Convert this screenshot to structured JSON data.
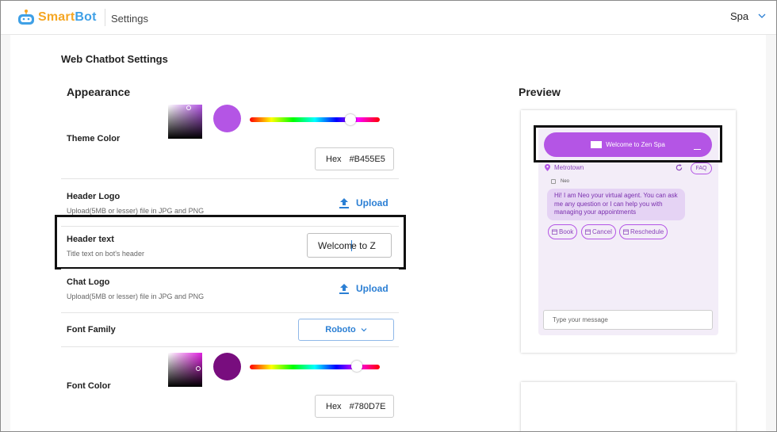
{
  "app": {
    "brand_part1": "Smart",
    "brand_part2": "Bot",
    "page": "Settings",
    "org": "Spa"
  },
  "page_title": "Web Chatbot Settings",
  "appearance": {
    "title": "Appearance",
    "theme_color": {
      "label": "Theme Color",
      "hex_label": "Hex",
      "hex_value": "#B455E5",
      "hue_position": 0.78
    },
    "header_logo": {
      "label": "Header Logo",
      "sub": "Upload(5MB or lesser) file in JPG and PNG",
      "button": "Upload"
    },
    "header_text": {
      "label": "Header text",
      "sub": "Title text on bot's header",
      "value_before_caret": "Welcom",
      "value_after_caret": "e to Z"
    },
    "chat_logo": {
      "label": "Chat Logo",
      "sub": "Upload(5MB or lesser) file in JPG and PNG",
      "button": "Upload"
    },
    "font_family": {
      "label": "Font Family",
      "value": "Roboto"
    },
    "font_color": {
      "label": "Font Color",
      "hex_label": "Hex",
      "hex_value": "#780D7E",
      "hue_position": 0.82
    }
  },
  "preview": {
    "title": "Preview",
    "header_title": "Welcome to Zen Spa",
    "location": "Metrotown",
    "faq": "FAQ",
    "agent_name": "Neo",
    "message": "Hi! I am Neo your virtual agent. You can ask me any question or I can help you with managing your appointments",
    "chips": [
      "Book",
      "Cancel",
      "Reschedule"
    ],
    "input_placeholder": "Type your message"
  },
  "colors": {
    "theme": "#B455E5",
    "font": "#780D7E",
    "accent": "#2B7FD4"
  }
}
